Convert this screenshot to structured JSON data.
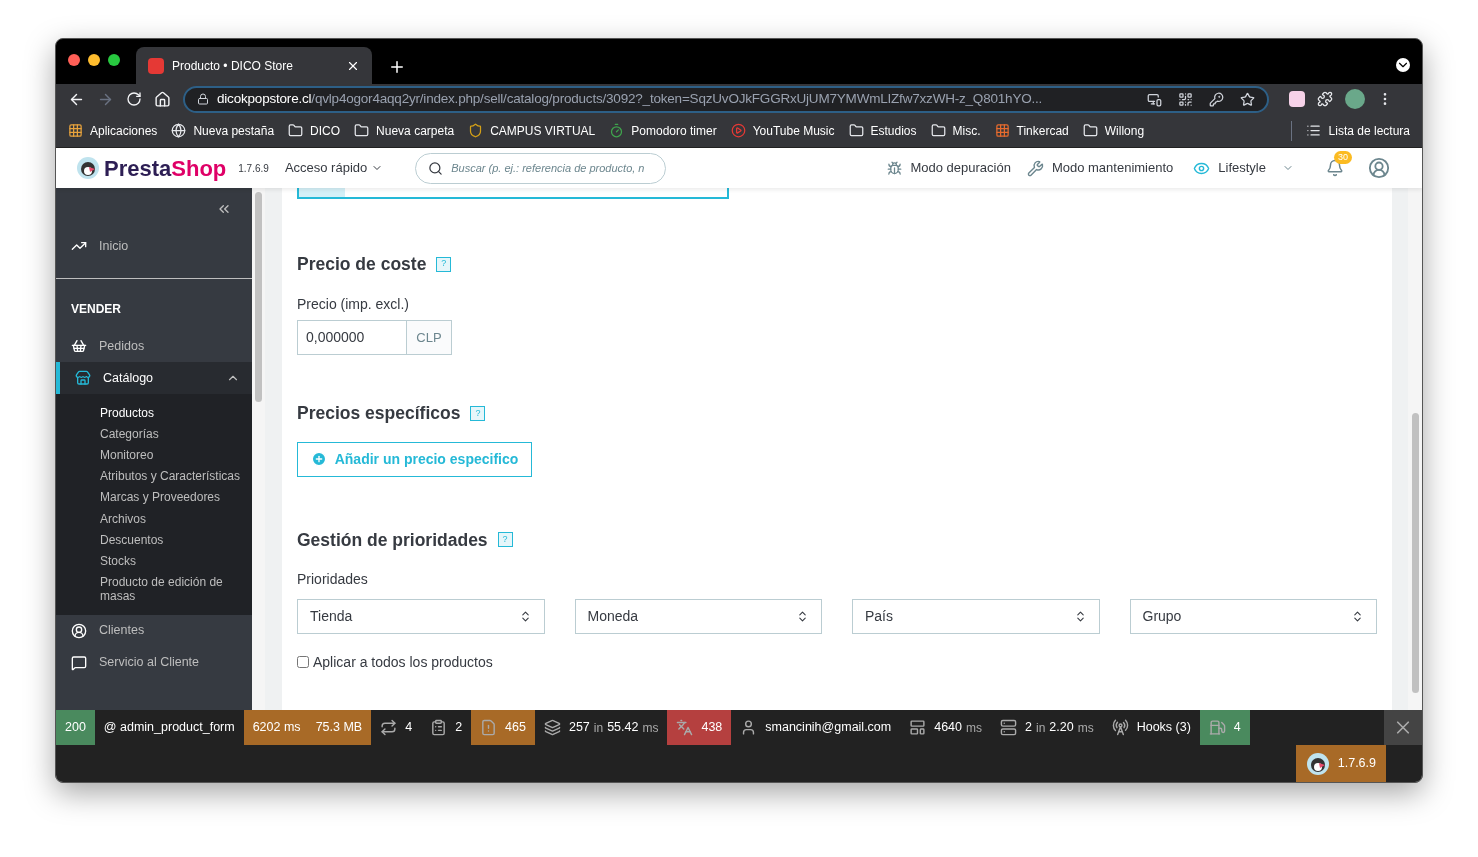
{
  "browser": {
    "tab_title": "Producto • DICO Store",
    "url_host": "dicokpopstore.cl",
    "url_path": "/qvlp4ogor4aqq2yr/index.php/sell/catalog/products/3092?_token=SqzUvOJkFGGRxUjUM7YMWmLIZfw7xzWH-z_Q801hYO...",
    "bookmarks": [
      {
        "label": "Aplicaciones",
        "kind": "apps"
      },
      {
        "label": "Nueva pestaña",
        "kind": "globe"
      },
      {
        "label": "DICO",
        "kind": "folder"
      },
      {
        "label": "Nueva carpeta",
        "kind": "folder"
      },
      {
        "label": "CAMPUS VIRTUAL",
        "kind": "crest"
      },
      {
        "label": "Pomodoro timer",
        "kind": "timer"
      },
      {
        "label": "YouTube Music",
        "kind": "music"
      },
      {
        "label": "Estudios",
        "kind": "folder"
      },
      {
        "label": "Misc.",
        "kind": "folder"
      },
      {
        "label": "Tinkercad",
        "kind": "grid"
      },
      {
        "label": "Willong",
        "kind": "folder"
      }
    ],
    "reading_list": "Lista de lectura"
  },
  "header": {
    "logo_first": "Presta",
    "logo_second": "Shop",
    "version": "1.7.6.9",
    "quick_access": "Acceso rápido",
    "search_placeholder": "Buscar (p. ej.: referencia de producto, n",
    "debug_mode": "Modo depuración",
    "maintenance_mode": "Modo mantenimiento",
    "shop": "Lifestyle",
    "notifications": "30"
  },
  "sidebar": {
    "items": [
      {
        "kind": "link",
        "label": "Inicio",
        "selected": false
      },
      {
        "kind": "section",
        "label": "VENDER"
      },
      {
        "kind": "link",
        "label": "Pedidos",
        "selected": false
      },
      {
        "kind": "link",
        "label": "Catálogo",
        "selected": true,
        "expanded": true,
        "children": [
          {
            "label": "Productos",
            "selected": true
          },
          {
            "label": "Categorías",
            "selected": false
          },
          {
            "label": "Monitoreo",
            "selected": false
          },
          {
            "label": "Atributos y Características",
            "selected": false
          },
          {
            "label": "Marcas y Proveedores",
            "selected": false
          },
          {
            "label": "Archivos",
            "selected": false
          },
          {
            "label": "Descuentos",
            "selected": false
          },
          {
            "label": "Stocks",
            "selected": false
          },
          {
            "label": "Producto de edición de masas",
            "selected": false
          }
        ]
      },
      {
        "kind": "link",
        "label": "Clientes",
        "selected": false
      },
      {
        "kind": "link",
        "label": "Servicio al Cliente",
        "selected": false
      }
    ]
  },
  "content": {
    "cost_price": {
      "title": "Precio de coste",
      "help": "?",
      "label": "Precio (imp. excl.)",
      "value": "0,000000",
      "currency": "CLP"
    },
    "specific_prices": {
      "title": "Precios específicos",
      "help": "?",
      "add_button": "Añadir un precio especifico"
    },
    "priorities": {
      "title": "Gestión de prioridades",
      "help": "?",
      "label": "Prioridades",
      "selects": [
        "Tienda",
        "Moneda",
        "País",
        "Grupo"
      ],
      "apply_all": {
        "label": "Aplicar a todos los productos",
        "checked": false
      }
    }
  },
  "debug_bar": {
    "items": [
      {
        "color": "#4a8a5e",
        "parts": [
          {
            "text": "200",
            "dim": false
          }
        ]
      },
      {
        "parts": [
          {
            "text": "@ admin_product_form",
            "dim": false
          }
        ]
      },
      {
        "color": "#a86a27",
        "parts": [
          {
            "text": "6202 ms",
            "dim": false
          },
          {
            "text": "75.3 MB",
            "dim": false
          }
        ]
      },
      {
        "parts": [
          {
            "text": "4",
            "dim": false
          }
        ]
      },
      {
        "parts": [
          {
            "text": "2",
            "dim": false
          }
        ]
      },
      {
        "color": "#a86a27",
        "parts": [
          {
            "text": "465",
            "dim": false
          }
        ]
      },
      {
        "parts": [
          {
            "text": "257",
            "dim": false
          },
          {
            "text": "in",
            "dim": true
          },
          {
            "text": "55.42",
            "dim": false
          },
          {
            "text": "ms",
            "dim": true
          }
        ]
      },
      {
        "color": "#b5403f",
        "parts": [
          {
            "text": "438",
            "dim": false
          }
        ]
      },
      {
        "parts": [
          {
            "text": "smancinih@gmail.com",
            "dim": false
          }
        ]
      },
      {
        "parts": [
          {
            "text": "4640",
            "dim": false
          },
          {
            "text": "ms",
            "dim": true
          }
        ]
      },
      {
        "parts": [
          {
            "text": "2",
            "dim": false
          },
          {
            "text": "in",
            "dim": true
          },
          {
            "text": "2.20",
            "dim": false
          },
          {
            "text": "ms",
            "dim": true
          }
        ]
      },
      {
        "parts": [
          {
            "text": "Hooks (3)",
            "dim": false
          }
        ]
      },
      {
        "color": "#4a8a5e",
        "parts": [
          {
            "text": "4",
            "dim": false
          }
        ]
      }
    ],
    "version_badge": "1.7.6.9"
  }
}
